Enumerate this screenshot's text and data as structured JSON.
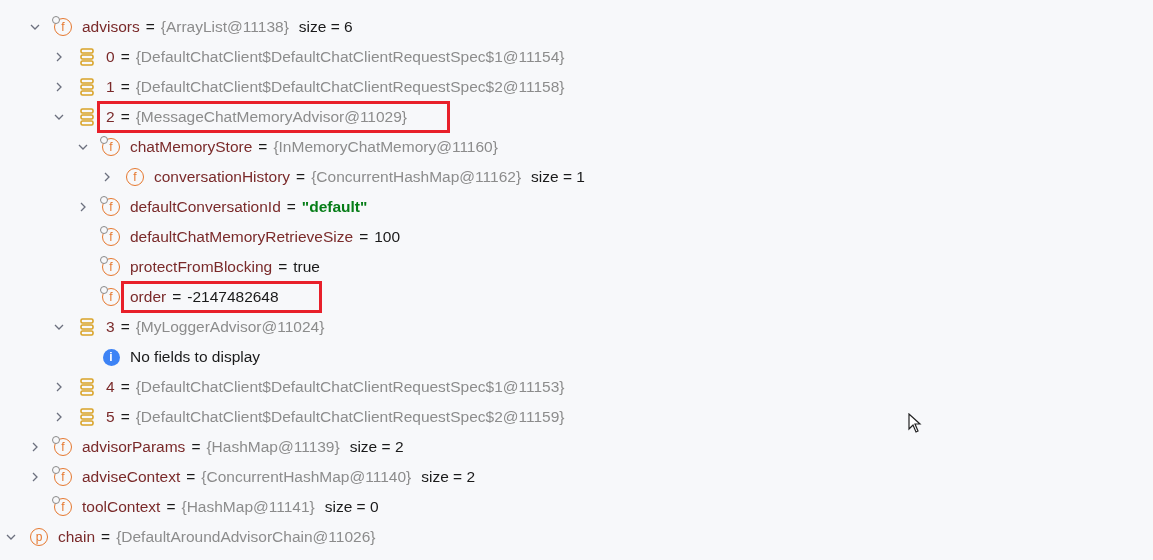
{
  "tree": [
    {
      "kind": "continuation",
      "children": [
        {
          "kind": "field",
          "badge": "f",
          "marked": true,
          "expanded": true,
          "name": "advisors",
          "eq": "=",
          "ref": "{ArrayList@11138}",
          "size": "size = 6",
          "children": [
            {
              "kind": "element",
              "expanded": false,
              "name": "0",
              "eq": "=",
              "ref": "{DefaultChatClient$DefaultChatClientRequestSpec$1@11154}"
            },
            {
              "kind": "element",
              "expanded": false,
              "name": "1",
              "eq": "=",
              "ref": "{DefaultChatClient$DefaultChatClientRequestSpec$2@11158}"
            },
            {
              "kind": "element",
              "expanded": true,
              "highlighted": true,
              "name": "2",
              "eq": "=",
              "ref": "{MessageChatMemoryAdvisor@11029}",
              "children": [
                {
                  "kind": "field",
                  "badge": "f",
                  "marked": true,
                  "expanded": true,
                  "name": "chatMemoryStore",
                  "eq": "=",
                  "ref": "{InMemoryChatMemory@11160}",
                  "children": [
                    {
                      "kind": "field",
                      "badge": "f",
                      "marked": false,
                      "expanded": false,
                      "name": "conversationHistory",
                      "eq": "=",
                      "ref": "{ConcurrentHashMap@11162}",
                      "size": "size = 1"
                    }
                  ]
                },
                {
                  "kind": "field",
                  "badge": "f",
                  "marked": true,
                  "expanded": false,
                  "name": "defaultConversationId",
                  "eq": "=",
                  "string": "\"default\""
                },
                {
                  "kind": "field",
                  "badge": "f",
                  "marked": true,
                  "name": "defaultChatMemoryRetrieveSize",
                  "eq": "=",
                  "literal": "100"
                },
                {
                  "kind": "field",
                  "badge": "f",
                  "marked": true,
                  "name": "protectFromBlocking",
                  "eq": "=",
                  "literal": "true"
                },
                {
                  "kind": "field",
                  "badge": "f",
                  "marked": true,
                  "highlighted": true,
                  "name": "order",
                  "eq": "=",
                  "literal": "-2147482648"
                }
              ]
            },
            {
              "kind": "element",
              "expanded": true,
              "name": "3",
              "eq": "=",
              "ref": "{MyLoggerAdvisor@11024}",
              "children": [
                {
                  "kind": "info",
                  "badge": "i",
                  "name": "No fields to display"
                }
              ]
            },
            {
              "kind": "element",
              "expanded": false,
              "name": "4",
              "eq": "=",
              "ref": "{DefaultChatClient$DefaultChatClientRequestSpec$1@11153}"
            },
            {
              "kind": "element",
              "expanded": false,
              "name": "5",
              "eq": "=",
              "ref": "{DefaultChatClient$DefaultChatClientRequestSpec$2@11159}"
            }
          ]
        },
        {
          "kind": "field",
          "badge": "f",
          "marked": true,
          "expanded": false,
          "name": "advisorParams",
          "eq": "=",
          "ref": "{HashMap@11139}",
          "size": "size = 2"
        },
        {
          "kind": "field",
          "badge": "f",
          "marked": true,
          "expanded": false,
          "name": "adviseContext",
          "eq": "=",
          "ref": "{ConcurrentHashMap@11140}",
          "size": "size = 2"
        },
        {
          "kind": "field",
          "badge": "f",
          "marked": true,
          "name": "toolContext",
          "eq": "=",
          "ref": "{HashMap@11141}",
          "size": "size = 0"
        }
      ]
    },
    {
      "kind": "parameter",
      "badge": "p",
      "expanded": true,
      "name": "chain",
      "eq": "=",
      "ref": "{DefaultAroundAdvisorChain@11026}"
    }
  ]
}
